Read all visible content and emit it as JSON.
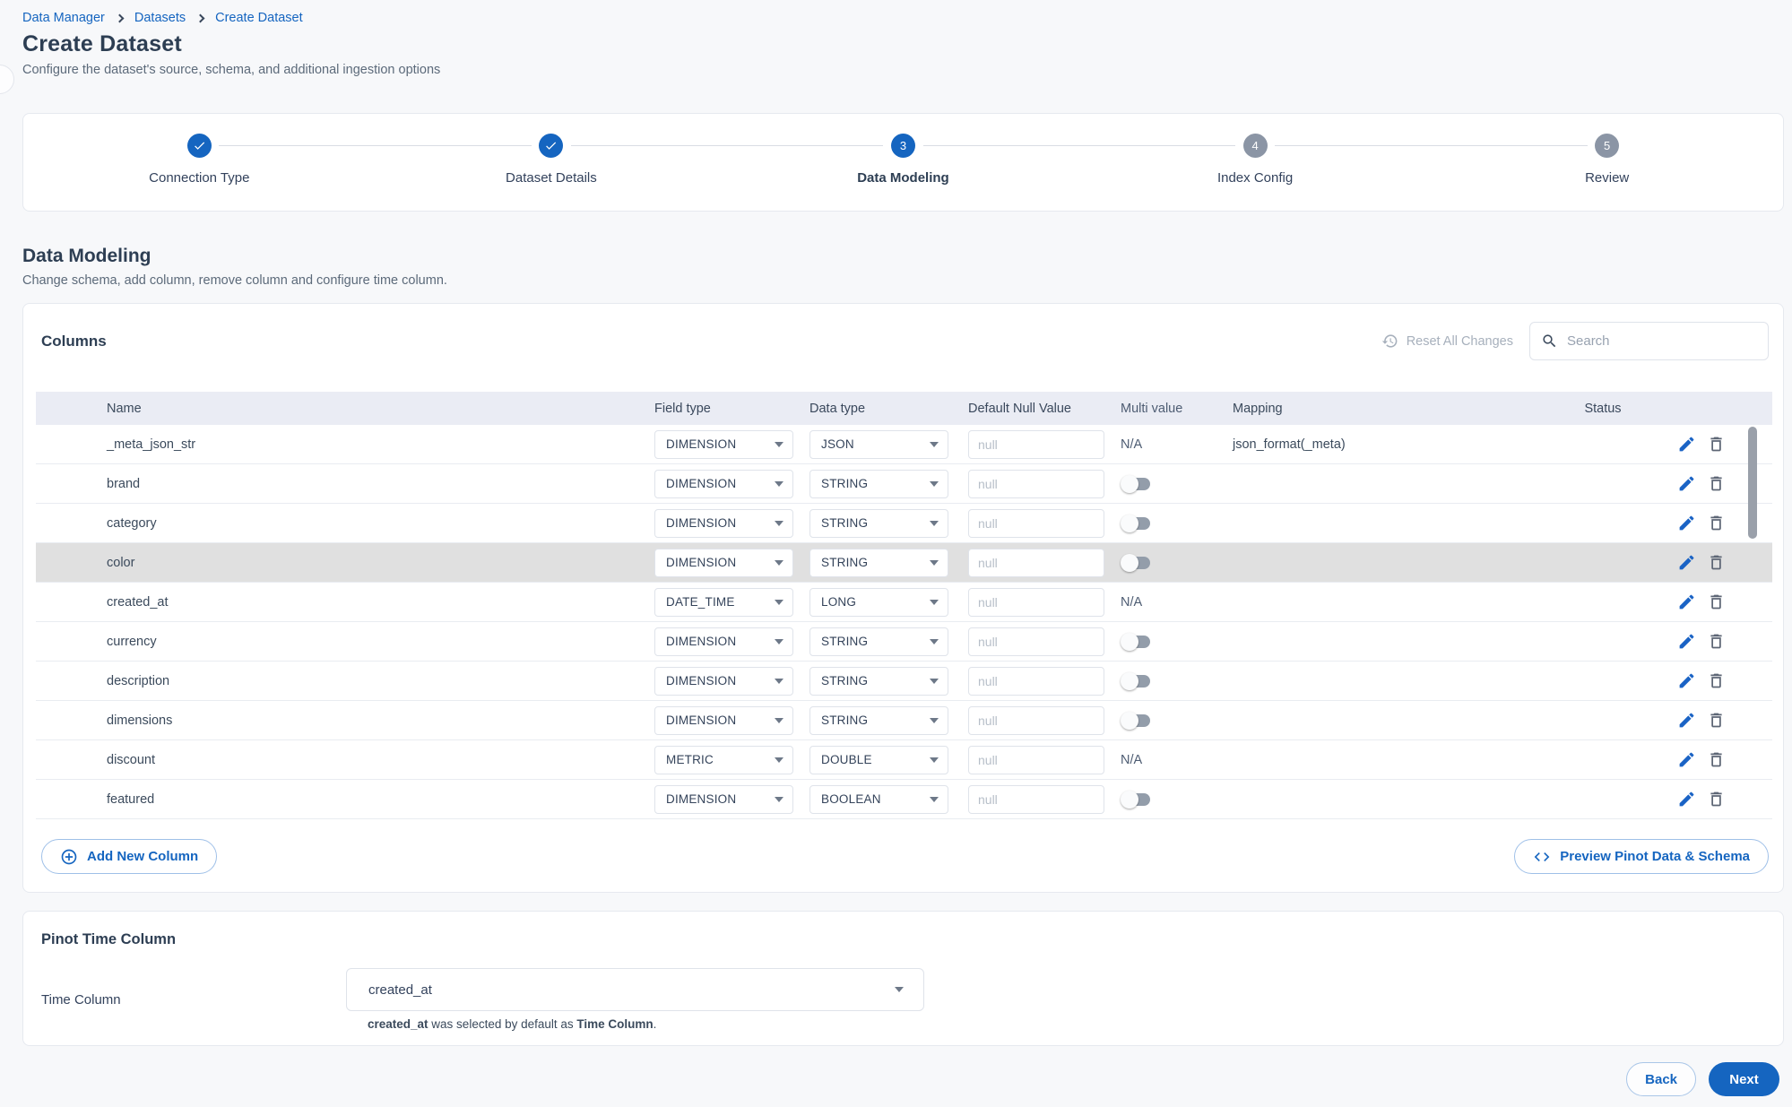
{
  "colors": {
    "accent": "#1565c0",
    "table_header": "#eaecf4",
    "row_highlight": "#e0e0e0",
    "toggle_track": "#939daa",
    "disabled_text": "#a7b0bc"
  },
  "breadcrumb": {
    "items": [
      {
        "label": "Data Manager"
      },
      {
        "label": "Datasets"
      },
      {
        "label": "Create Dataset"
      }
    ]
  },
  "header": {
    "title": "Create Dataset",
    "subtitle": "Configure the dataset's source, schema, and additional ingestion options"
  },
  "stepper": {
    "steps": [
      {
        "label": "Connection Type",
        "state": "completed",
        "number": "1"
      },
      {
        "label": "Dataset Details",
        "state": "completed",
        "number": "2"
      },
      {
        "label": "Data Modeling",
        "state": "active",
        "number": "3"
      },
      {
        "label": "Index Config",
        "state": "upcoming",
        "number": "4"
      },
      {
        "label": "Review",
        "state": "upcoming",
        "number": "5"
      }
    ]
  },
  "section": {
    "title": "Data Modeling",
    "subtitle": "Change schema, add column, remove column and configure time column."
  },
  "columns_panel": {
    "title": "Columns",
    "reset_button": "Reset All Changes",
    "search_placeholder": "Search",
    "table": {
      "headers": [
        "Name",
        "Field type",
        "Data type",
        "Default Null Value",
        "Multi value",
        "Mapping",
        "Status"
      ],
      "null_placeholder": "null",
      "na_label": "N/A",
      "rows": [
        {
          "name": "_meta_json_str",
          "field_type": "DIMENSION",
          "data_type": "JSON",
          "default_null": "",
          "multi_value": "na",
          "mapping": "json_format(_meta)",
          "status": "",
          "highlighted": false
        },
        {
          "name": "brand",
          "field_type": "DIMENSION",
          "data_type": "STRING",
          "default_null": "",
          "multi_value": "toggle-off",
          "mapping": "",
          "status": "",
          "highlighted": false
        },
        {
          "name": "category",
          "field_type": "DIMENSION",
          "data_type": "STRING",
          "default_null": "",
          "multi_value": "toggle-off",
          "mapping": "",
          "status": "",
          "highlighted": false
        },
        {
          "name": "color",
          "field_type": "DIMENSION",
          "data_type": "STRING",
          "default_null": "",
          "multi_value": "toggle-off",
          "mapping": "",
          "status": "",
          "highlighted": true
        },
        {
          "name": "created_at",
          "field_type": "DATE_TIME",
          "data_type": "LONG",
          "default_null": "",
          "multi_value": "na",
          "mapping": "",
          "status": "",
          "highlighted": false
        },
        {
          "name": "currency",
          "field_type": "DIMENSION",
          "data_type": "STRING",
          "default_null": "",
          "multi_value": "toggle-off",
          "mapping": "",
          "status": "",
          "highlighted": false
        },
        {
          "name": "description",
          "field_type": "DIMENSION",
          "data_type": "STRING",
          "default_null": "",
          "multi_value": "toggle-off",
          "mapping": "",
          "status": "",
          "highlighted": false
        },
        {
          "name": "dimensions",
          "field_type": "DIMENSION",
          "data_type": "STRING",
          "default_null": "",
          "multi_value": "toggle-off",
          "mapping": "",
          "status": "",
          "highlighted": false
        },
        {
          "name": "discount",
          "field_type": "METRIC",
          "data_type": "DOUBLE",
          "default_null": "",
          "multi_value": "na",
          "mapping": "",
          "status": "",
          "highlighted": false
        },
        {
          "name": "featured",
          "field_type": "DIMENSION",
          "data_type": "BOOLEAN",
          "default_null": "",
          "multi_value": "toggle-off",
          "mapping": "",
          "status": "",
          "highlighted": false
        }
      ]
    },
    "add_column_button": "Add New Column",
    "preview_button": "Preview Pinot Data & Schema"
  },
  "time_column_panel": {
    "title": "Pinot Time Column",
    "field_label": "Time Column",
    "selected_value": "created_at",
    "helper_bold_1": "created_at",
    "helper_middle": " was selected by default as ",
    "helper_bold_2": "Time Column",
    "helper_suffix": "."
  },
  "footer": {
    "back_label": "Back",
    "next_label": "Next"
  }
}
